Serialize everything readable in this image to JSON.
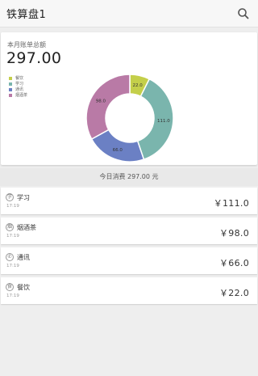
{
  "appbar": {
    "title": "铁算盘1",
    "search_icon": "search-icon"
  },
  "summary": {
    "label": "本月账单总额",
    "total": "297.00"
  },
  "legend": [
    {
      "label": "餐饮",
      "color": "#c4cf4a"
    },
    {
      "label": "学习",
      "color": "#7ab5ad"
    },
    {
      "label": "通讯",
      "color": "#6b80c4"
    },
    {
      "label": "烟酒茶",
      "color": "#b97aa6"
    }
  ],
  "chart_data": {
    "type": "pie",
    "donut": true,
    "slices": [
      {
        "label": "餐饮",
        "value": 22.0,
        "display": "22.0",
        "color": "#c4cf4a"
      },
      {
        "label": "学习",
        "value": 111.0,
        "display": "111.0",
        "color": "#7ab5ad"
      },
      {
        "label": "通讯",
        "value": 66.0,
        "display": "66.0",
        "color": "#6b80c4"
      },
      {
        "label": "烟酒茶",
        "value": 98.0,
        "display": "98.0",
        "color": "#b97aa6"
      }
    ]
  },
  "today": {
    "text": "今日消费 297.00 元"
  },
  "items": [
    {
      "icon": "book-icon",
      "icon_glyph": "学",
      "name": "学习",
      "time": "17:19",
      "amount": "￥111.0"
    },
    {
      "icon": "tea-icon",
      "icon_glyph": "烟",
      "name": "烟酒茶",
      "time": "17:19",
      "amount": "￥98.0"
    },
    {
      "icon": "phone-icon",
      "icon_glyph": "✆",
      "name": "通讯",
      "time": "17:19",
      "amount": "￥66.0"
    },
    {
      "icon": "dining-icon",
      "icon_glyph": "食",
      "name": "餐饮",
      "time": "17:19",
      "amount": "￥22.0"
    }
  ]
}
